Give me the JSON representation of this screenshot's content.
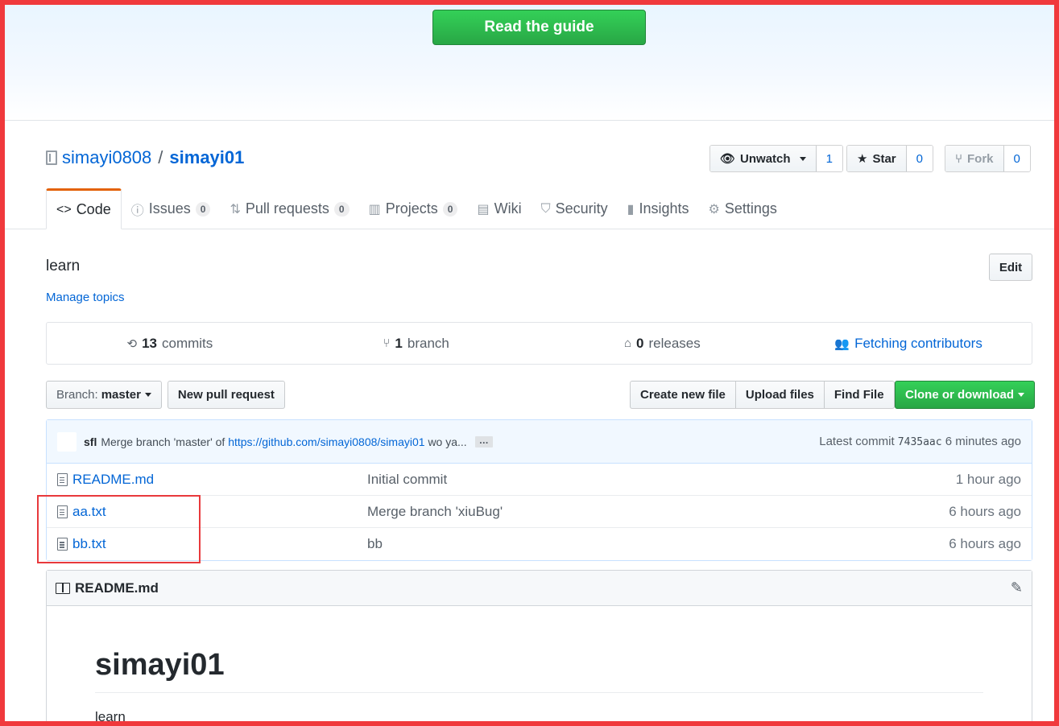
{
  "hero": {
    "button_label": "Read the guide"
  },
  "repo": {
    "owner": "simayi0808",
    "separator": "/",
    "name": "simayi01"
  },
  "actions": {
    "watch": {
      "label": "Unwatch",
      "count": "1"
    },
    "star": {
      "label": "Star",
      "count": "0"
    },
    "fork": {
      "label": "Fork",
      "count": "0"
    }
  },
  "tabs": [
    {
      "label": "Code",
      "badge": null,
      "icon": "code-icon"
    },
    {
      "label": "Issues",
      "badge": "0",
      "icon": "issue-icon"
    },
    {
      "label": "Pull requests",
      "badge": "0",
      "icon": "pull-request-icon"
    },
    {
      "label": "Projects",
      "badge": "0",
      "icon": "project-icon"
    },
    {
      "label": "Wiki",
      "badge": null,
      "icon": "book-icon"
    },
    {
      "label": "Security",
      "badge": null,
      "icon": "shield-icon"
    },
    {
      "label": "Insights",
      "badge": null,
      "icon": "graph-icon"
    },
    {
      "label": "Settings",
      "badge": null,
      "icon": "gear-icon"
    }
  ],
  "about": {
    "description": "learn",
    "edit_label": "Edit",
    "manage_topics": "Manage topics"
  },
  "summary": {
    "commits_count": "13",
    "commits_label": "commits",
    "branch_count": "1",
    "branch_label": "branch",
    "releases_count": "0",
    "releases_label": "releases",
    "contributors_label": "Fetching contributors"
  },
  "toolbar": {
    "branch_prefix": "Branch:",
    "branch_name": "master",
    "new_pr": "New pull request",
    "create_file": "Create new file",
    "upload_files": "Upload files",
    "find_file": "Find File",
    "clone": "Clone or download"
  },
  "latest_commit": {
    "author": "sfl",
    "message_prefix": "Merge branch 'master' of",
    "link": "https://github.com/simayi0808/simayi01",
    "message_suffix": "wo ya...",
    "ellipsis": "…",
    "latest_label": "Latest commit",
    "sha": "7435aac",
    "age": "6 minutes ago"
  },
  "files": [
    {
      "name": "README.md",
      "message": "Initial commit",
      "age": "1 hour ago"
    },
    {
      "name": "aa.txt",
      "message": "Merge branch 'xiuBug'",
      "age": "6 hours ago"
    },
    {
      "name": "bb.txt",
      "message": "bb",
      "age": "6 hours ago"
    }
  ],
  "readme": {
    "filename": "README.md",
    "heading": "simayi01",
    "body": "learn"
  },
  "colors": {
    "accent_green": "#28a745",
    "link_blue": "#0366d6",
    "tab_active_orange": "#e36209",
    "annotation_red": "#f0393c"
  }
}
